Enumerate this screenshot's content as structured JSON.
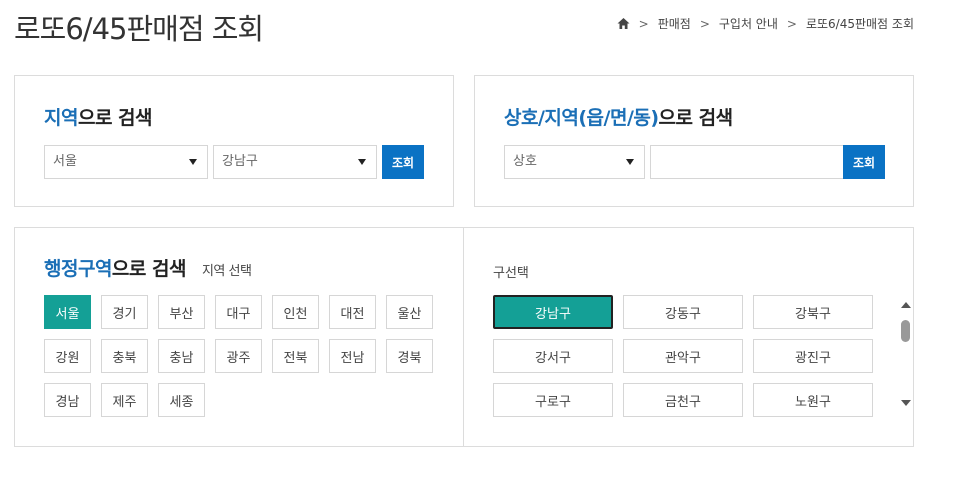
{
  "page": {
    "title": "로또6/45판매점 조회"
  },
  "breadcrumb": {
    "items": [
      "판매점",
      "구입처 안내",
      "로또6/45판매점 조회"
    ]
  },
  "region_search": {
    "heading_highlight": "지역",
    "heading_rest": "으로 검색",
    "city_value": "서울",
    "district_value": "강남구",
    "search_label": "조회"
  },
  "name_search": {
    "heading_highlight": "상호/지역(읍/면/동)",
    "heading_rest": "으로 검색",
    "type_value": "상호",
    "keyword_value": "",
    "search_label": "조회"
  },
  "admin_search": {
    "heading_highlight": "행정구역",
    "heading_rest": "으로 검색",
    "sub_label": "지역 선택",
    "regions": [
      "서울",
      "경기",
      "부산",
      "대구",
      "인천",
      "대전",
      "울산",
      "강원",
      "충북",
      "충남",
      "광주",
      "전북",
      "전남",
      "경북",
      "경남",
      "제주",
      "세종"
    ],
    "selected_region": "서울",
    "district_label": "구선택",
    "districts": [
      "강남구",
      "강동구",
      "강북구",
      "강서구",
      "관악구",
      "광진구",
      "구로구",
      "금천구",
      "노원구"
    ],
    "selected_district": "강남구"
  },
  "colors": {
    "accent_blue": "#0a72c4",
    "heading_blue": "#1b6fb6",
    "active_teal": "#14a096"
  }
}
